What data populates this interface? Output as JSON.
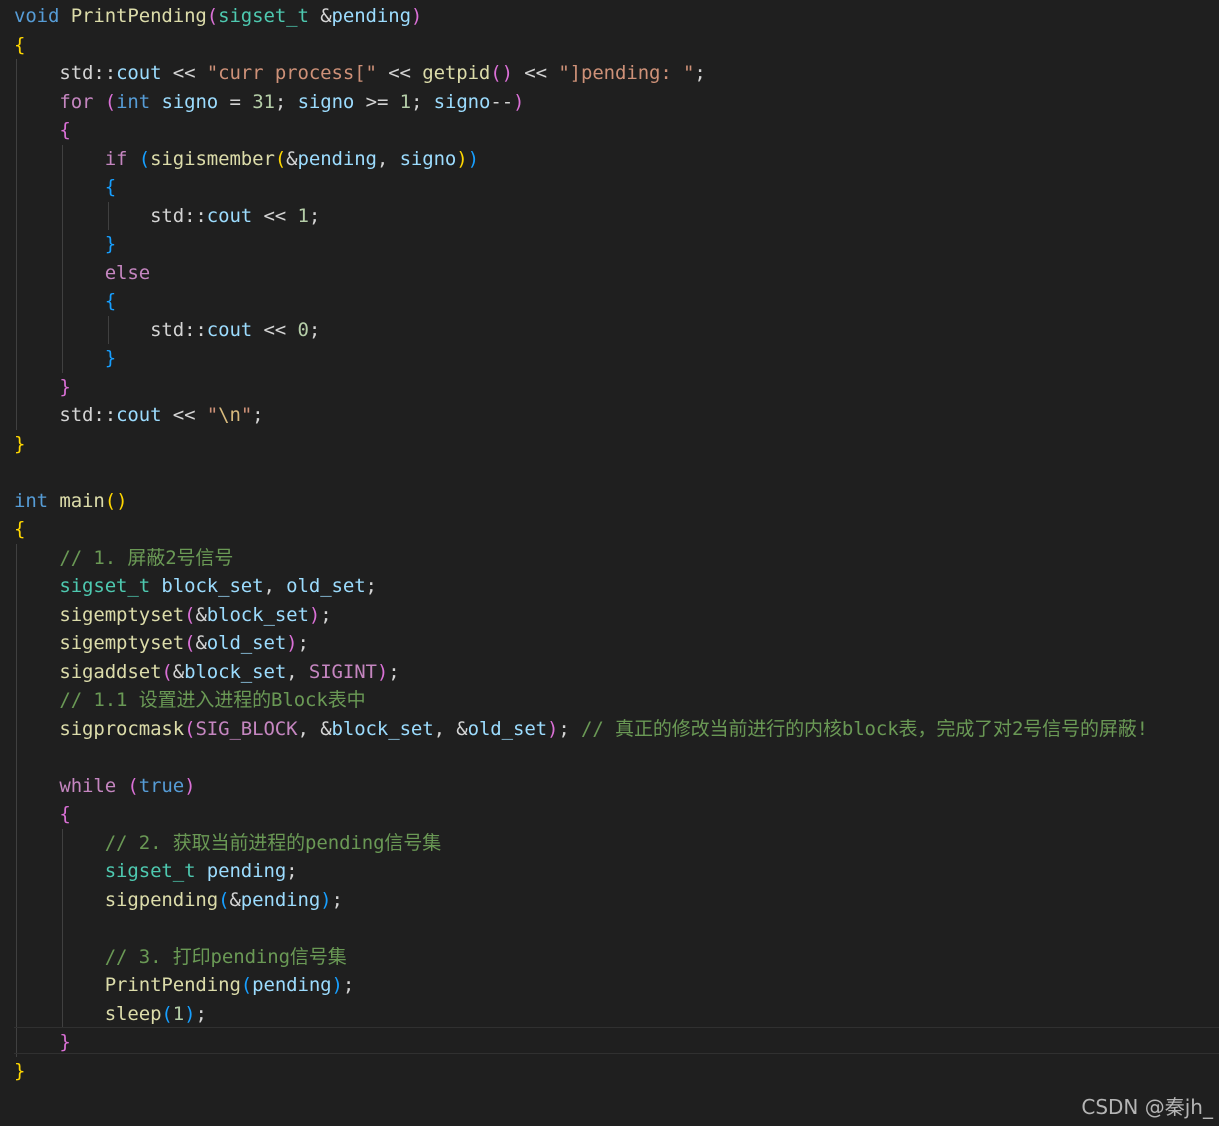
{
  "theme": {
    "background": "#1f1f1f",
    "default": "#d4d4d4",
    "keyword": "#569cd6",
    "control": "#c586c0",
    "function": "#dcdcaa",
    "type": "#4ec9b0",
    "variable": "#9cdcfe",
    "param": "#9cdcfe",
    "string": "#ce9178",
    "escape": "#d7ba7d",
    "number": "#b5cea8",
    "comment": "#6a9955",
    "macro": "#c586c0",
    "bracket1": "#ffd700",
    "bracket2": "#da70d6",
    "bracket3": "#179fff"
  },
  "code": {
    "current_line": 36,
    "lines": [
      [
        [
          "void",
          "keyword"
        ],
        [
          " ",
          "default"
        ],
        [
          "PrintPending",
          "function"
        ],
        [
          "(",
          "bracket2"
        ],
        [
          "sigset_t",
          "type"
        ],
        [
          " ",
          "default"
        ],
        [
          "&",
          "default"
        ],
        [
          "pending",
          "param"
        ],
        [
          ")",
          "bracket2"
        ]
      ],
      [
        [
          "{",
          "bracket1"
        ]
      ],
      [
        [
          "    std::",
          "default"
        ],
        [
          "cout",
          "variable"
        ],
        [
          " << ",
          "default"
        ],
        [
          "\"curr process[\"",
          "string"
        ],
        [
          " << ",
          "default"
        ],
        [
          "getpid",
          "function"
        ],
        [
          "()",
          "bracket2"
        ],
        [
          " << ",
          "default"
        ],
        [
          "\"]pending: \"",
          "string"
        ],
        [
          ";",
          "default"
        ]
      ],
      [
        [
          "    ",
          "default"
        ],
        [
          "for",
          "control"
        ],
        [
          " ",
          "default"
        ],
        [
          "(",
          "bracket2"
        ],
        [
          "int",
          "keyword"
        ],
        [
          " ",
          "default"
        ],
        [
          "signo",
          "variable"
        ],
        [
          " = ",
          "default"
        ],
        [
          "31",
          "number"
        ],
        [
          "; ",
          "default"
        ],
        [
          "signo",
          "variable"
        ],
        [
          " >= ",
          "default"
        ],
        [
          "1",
          "number"
        ],
        [
          "; ",
          "default"
        ],
        [
          "signo",
          "variable"
        ],
        [
          "--",
          "default"
        ],
        [
          ")",
          "bracket2"
        ]
      ],
      [
        [
          "    ",
          "default"
        ],
        [
          "{",
          "bracket2"
        ]
      ],
      [
        [
          "        ",
          "default"
        ],
        [
          "if",
          "control"
        ],
        [
          " ",
          "default"
        ],
        [
          "(",
          "bracket3"
        ],
        [
          "sigismember",
          "function"
        ],
        [
          "(",
          "bracket1"
        ],
        [
          "&",
          "default"
        ],
        [
          "pending",
          "param"
        ],
        [
          ", ",
          "default"
        ],
        [
          "signo",
          "variable"
        ],
        [
          ")",
          "bracket1"
        ],
        [
          ")",
          "bracket3"
        ]
      ],
      [
        [
          "        ",
          "default"
        ],
        [
          "{",
          "bracket3"
        ]
      ],
      [
        [
          "            std::",
          "default"
        ],
        [
          "cout",
          "variable"
        ],
        [
          " << ",
          "default"
        ],
        [
          "1",
          "number"
        ],
        [
          ";",
          "default"
        ]
      ],
      [
        [
          "        ",
          "default"
        ],
        [
          "}",
          "bracket3"
        ]
      ],
      [
        [
          "        ",
          "default"
        ],
        [
          "else",
          "control"
        ]
      ],
      [
        [
          "        ",
          "default"
        ],
        [
          "{",
          "bracket3"
        ]
      ],
      [
        [
          "            std::",
          "default"
        ],
        [
          "cout",
          "variable"
        ],
        [
          " << ",
          "default"
        ],
        [
          "0",
          "number"
        ],
        [
          ";",
          "default"
        ]
      ],
      [
        [
          "        ",
          "default"
        ],
        [
          "}",
          "bracket3"
        ]
      ],
      [
        [
          "    ",
          "default"
        ],
        [
          "}",
          "bracket2"
        ]
      ],
      [
        [
          "    std::",
          "default"
        ],
        [
          "cout",
          "variable"
        ],
        [
          " << ",
          "default"
        ],
        [
          "\"",
          "string"
        ],
        [
          "\\n",
          "escape"
        ],
        [
          "\"",
          "string"
        ],
        [
          ";",
          "default"
        ]
      ],
      [
        [
          "}",
          "bracket1"
        ]
      ],
      [],
      [
        [
          "int",
          "keyword"
        ],
        [
          " ",
          "default"
        ],
        [
          "main",
          "function"
        ],
        [
          "()",
          "bracket1"
        ]
      ],
      [
        [
          "{",
          "bracket1"
        ]
      ],
      [
        [
          "    ",
          "default"
        ],
        [
          "// 1. 屏蔽2号信号",
          "comment"
        ]
      ],
      [
        [
          "    ",
          "default"
        ],
        [
          "sigset_t",
          "type"
        ],
        [
          " ",
          "default"
        ],
        [
          "block_set",
          "variable"
        ],
        [
          ", ",
          "default"
        ],
        [
          "old_set",
          "variable"
        ],
        [
          ";",
          "default"
        ]
      ],
      [
        [
          "    ",
          "default"
        ],
        [
          "sigemptyset",
          "function"
        ],
        [
          "(",
          "bracket2"
        ],
        [
          "&",
          "default"
        ],
        [
          "block_set",
          "variable"
        ],
        [
          ")",
          "bracket2"
        ],
        [
          ";",
          "default"
        ]
      ],
      [
        [
          "    ",
          "default"
        ],
        [
          "sigemptyset",
          "function"
        ],
        [
          "(",
          "bracket2"
        ],
        [
          "&",
          "default"
        ],
        [
          "old_set",
          "variable"
        ],
        [
          ")",
          "bracket2"
        ],
        [
          ";",
          "default"
        ]
      ],
      [
        [
          "    ",
          "default"
        ],
        [
          "sigaddset",
          "function"
        ],
        [
          "(",
          "bracket2"
        ],
        [
          "&",
          "default"
        ],
        [
          "block_set",
          "variable"
        ],
        [
          ", ",
          "default"
        ],
        [
          "SIGINT",
          "macro"
        ],
        [
          ")",
          "bracket2"
        ],
        [
          ";",
          "default"
        ]
      ],
      [
        [
          "    ",
          "default"
        ],
        [
          "// 1.1 设置进入进程的Block表中",
          "comment"
        ]
      ],
      [
        [
          "    ",
          "default"
        ],
        [
          "sigprocmask",
          "function"
        ],
        [
          "(",
          "bracket2"
        ],
        [
          "SIG_BLOCK",
          "macro"
        ],
        [
          ", ",
          "default"
        ],
        [
          "&",
          "default"
        ],
        [
          "block_set",
          "variable"
        ],
        [
          ", ",
          "default"
        ],
        [
          "&",
          "default"
        ],
        [
          "old_set",
          "variable"
        ],
        [
          ")",
          "bracket2"
        ],
        [
          "; ",
          "default"
        ],
        [
          "// 真正的修改当前进行的内核block表，完成了对2号信号的屏蔽!",
          "comment"
        ]
      ],
      [],
      [
        [
          "    ",
          "default"
        ],
        [
          "while",
          "control"
        ],
        [
          " ",
          "default"
        ],
        [
          "(",
          "bracket2"
        ],
        [
          "true",
          "keyword"
        ],
        [
          ")",
          "bracket2"
        ]
      ],
      [
        [
          "    ",
          "default"
        ],
        [
          "{",
          "bracket2"
        ]
      ],
      [
        [
          "        ",
          "default"
        ],
        [
          "// 2. 获取当前进程的pending信号集",
          "comment"
        ]
      ],
      [
        [
          "        ",
          "default"
        ],
        [
          "sigset_t",
          "type"
        ],
        [
          " ",
          "default"
        ],
        [
          "pending",
          "variable"
        ],
        [
          ";",
          "default"
        ]
      ],
      [
        [
          "        ",
          "default"
        ],
        [
          "sigpending",
          "function"
        ],
        [
          "(",
          "bracket3"
        ],
        [
          "&",
          "default"
        ],
        [
          "pending",
          "variable"
        ],
        [
          ")",
          "bracket3"
        ],
        [
          ";",
          "default"
        ]
      ],
      [],
      [
        [
          "        ",
          "default"
        ],
        [
          "// 3. 打印pending信号集",
          "comment"
        ]
      ],
      [
        [
          "        ",
          "default"
        ],
        [
          "PrintPending",
          "function"
        ],
        [
          "(",
          "bracket3"
        ],
        [
          "pending",
          "variable"
        ],
        [
          ")",
          "bracket3"
        ],
        [
          ";",
          "default"
        ]
      ],
      [
        [
          "        ",
          "default"
        ],
        [
          "sleep",
          "function"
        ],
        [
          "(",
          "bracket3"
        ],
        [
          "1",
          "number"
        ],
        [
          ")",
          "bracket3"
        ],
        [
          ";",
          "default"
        ]
      ],
      [
        [
          "    ",
          "default"
        ],
        [
          "}",
          "bracket2"
        ]
      ],
      [
        [
          "}",
          "bracket1"
        ]
      ]
    ]
  },
  "watermark": "CSDN @秦jh_"
}
